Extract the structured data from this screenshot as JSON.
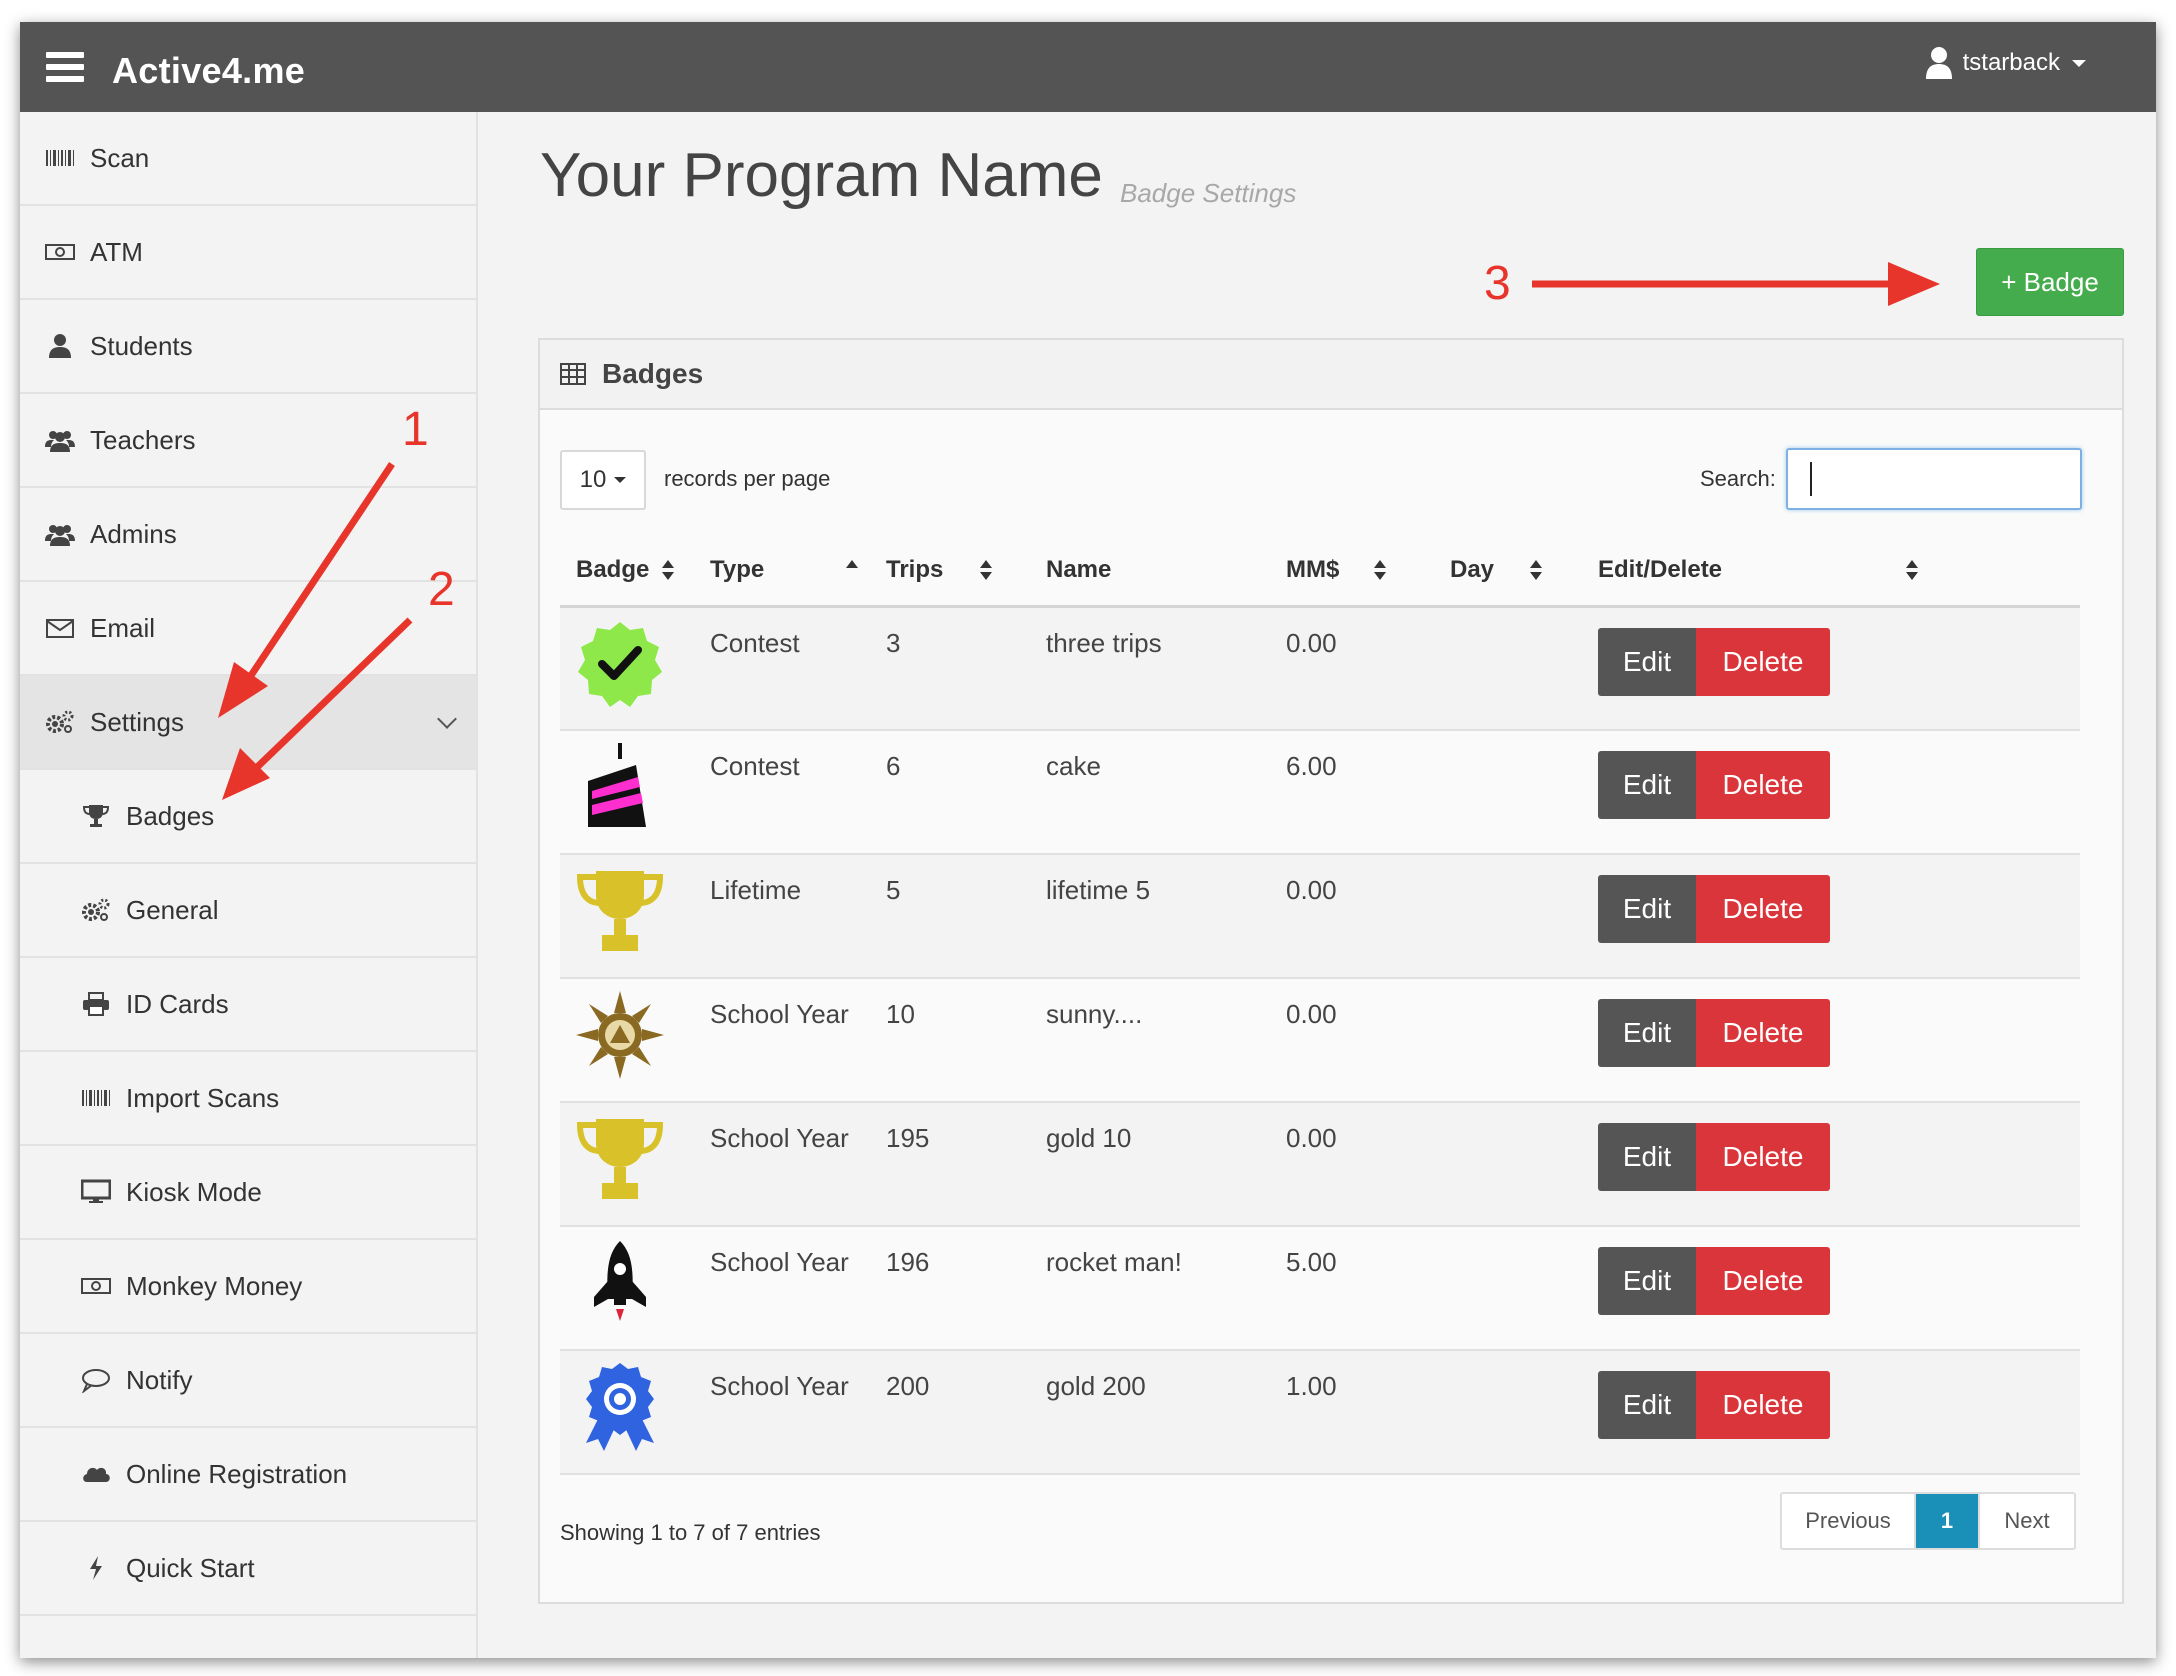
{
  "app": {
    "brand": "Active4.me",
    "username": "tstarback"
  },
  "sidebar": {
    "items": [
      {
        "label": "Scan",
        "icon": "barcode-icon"
      },
      {
        "label": "ATM",
        "icon": "money-icon"
      },
      {
        "label": "Students",
        "icon": "user-icon"
      },
      {
        "label": "Teachers",
        "icon": "users-icon"
      },
      {
        "label": "Admins",
        "icon": "users-icon"
      },
      {
        "label": "Email",
        "icon": "envelope-icon"
      },
      {
        "label": "Settings",
        "icon": "cogs-icon",
        "expanded": true
      },
      {
        "label": "Badges",
        "icon": "trophy-icon"
      },
      {
        "label": "General",
        "icon": "cogs-icon"
      },
      {
        "label": "ID Cards",
        "icon": "print-icon"
      },
      {
        "label": "Import Scans",
        "icon": "barcode-icon"
      },
      {
        "label": "Kiosk Mode",
        "icon": "monitor-icon"
      },
      {
        "label": "Monkey Money",
        "icon": "money-icon"
      },
      {
        "label": "Notify",
        "icon": "comment-icon"
      },
      {
        "label": "Online Registration",
        "icon": "cloud-icon"
      },
      {
        "label": "Quick Start",
        "icon": "bolt-icon"
      }
    ]
  },
  "header": {
    "title": "Your Program Name",
    "subtitle": "Badge Settings",
    "add_button": "+ Badge"
  },
  "panel": {
    "title": "Badges",
    "length_value": "10",
    "length_label": "records per page",
    "search_label": "Search:",
    "search_value": "",
    "columns": [
      "Badge",
      "Type",
      "Trips",
      "Name",
      "MM$",
      "Day",
      "Edit/Delete"
    ],
    "rows": [
      {
        "icon": "green-check-badge-icon",
        "type": "Contest",
        "trips": "3",
        "name": "three trips",
        "mm": "0.00",
        "day": ""
      },
      {
        "icon": "cake-icon",
        "type": "Contest",
        "trips": "6",
        "name": "cake",
        "mm": "6.00",
        "day": ""
      },
      {
        "icon": "gold-trophy-icon",
        "type": "Lifetime",
        "trips": "5",
        "name": "lifetime 5",
        "mm": "0.00",
        "day": ""
      },
      {
        "icon": "sun-icon",
        "type": "School Year",
        "trips": "10",
        "name": "sunny....",
        "mm": "0.00",
        "day": ""
      },
      {
        "icon": "gold-trophy-icon",
        "type": "School Year",
        "trips": "195",
        "name": "gold 10",
        "mm": "0.00",
        "day": ""
      },
      {
        "icon": "rocket-icon",
        "type": "School Year",
        "trips": "196",
        "name": "rocket man!",
        "mm": "5.00",
        "day": ""
      },
      {
        "icon": "blue-ribbon-icon",
        "type": "School Year",
        "trips": "200",
        "name": "gold 200",
        "mm": "1.00",
        "day": ""
      }
    ],
    "edit_label": "Edit",
    "delete_label": "Delete",
    "info": "Showing 1 to 7 of 7 entries",
    "pager": {
      "previous": "Previous",
      "current": "1",
      "next": "Next"
    }
  },
  "annotations": [
    "1",
    "2",
    "3"
  ],
  "colors": {
    "topbar": "#545454",
    "add": "#44ac4c",
    "delete": "#d9353a",
    "edit": "#555555",
    "page_active": "#1a8fb7",
    "annotation": "#e8352b"
  }
}
